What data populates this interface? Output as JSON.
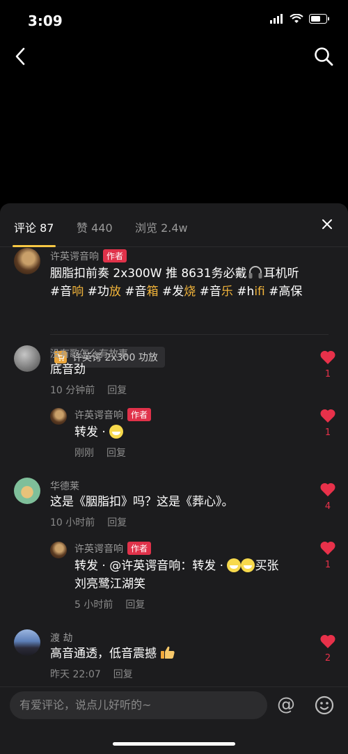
{
  "status_bar": {
    "time": "3:09"
  },
  "tabs": {
    "comments": {
      "label": "评论",
      "count": "87"
    },
    "likes": {
      "label": "赞",
      "count": "440"
    },
    "views": {
      "label": "浏览",
      "count": "2.4w"
    }
  },
  "post": {
    "author": "许英谔音响",
    "badge": "作者",
    "text_parts": {
      "a": "胭脂扣前奏 2x300W 推 8631务必戴",
      "b": "耳机听",
      "line2": [
        {
          "t": "#音",
          "hl": false
        },
        {
          "t": "响",
          "hl": true
        },
        {
          "t": " #功",
          "hl": false
        },
        {
          "t": "放",
          "hl": true
        },
        {
          "t": " #音",
          "hl": false
        },
        {
          "t": "箱",
          "hl": true
        },
        {
          "t": " #发",
          "hl": false
        },
        {
          "t": "烧",
          "hl": true
        },
        {
          "t": " #音",
          "hl": false
        },
        {
          "t": "乐",
          "hl": true
        },
        {
          "t": " #h",
          "hl": false
        },
        {
          "t": "ifi",
          "hl": true
        },
        {
          "t": " #高保",
          "hl": false
        }
      ]
    },
    "product": "许英谔 2x300 功放"
  },
  "comments": [
    {
      "user": "没有歌怎么有故事",
      "text": "底音劲",
      "time": "10 分钟前",
      "reply": "回复",
      "likes": "1",
      "replies": [
        {
          "user": "许英谔音响",
          "badge": "作者",
          "text": "转发 · ",
          "time": "刚刚",
          "reply": "回复",
          "likes": "1"
        }
      ]
    },
    {
      "user": "华德莱",
      "text": "这是《胭脂扣》吗？这是《葬心》。",
      "time": "10 小时前",
      "reply": "回复",
      "likes": "4",
      "replies": [
        {
          "user": "许英谔音响",
          "badge": "作者",
          "text_a": "转发 · @许英谔音响：转发 · ",
          "text_b": "买张",
          "text_c": "刘亮鹭江湖笑",
          "time": "5 小时前",
          "reply": "回复",
          "likes": "1"
        }
      ]
    },
    {
      "user": "渡 劫",
      "text": "高音通透，低音震撼 ",
      "time": "昨天 22:07",
      "reply": "回复",
      "likes": "2"
    }
  ],
  "input": {
    "placeholder": "有爱评论，说点儿好听的~"
  },
  "colors": {
    "accent": "#f7c844",
    "like": "#e8314a",
    "badge": "#e0324a",
    "tag": "#f2b43a"
  }
}
